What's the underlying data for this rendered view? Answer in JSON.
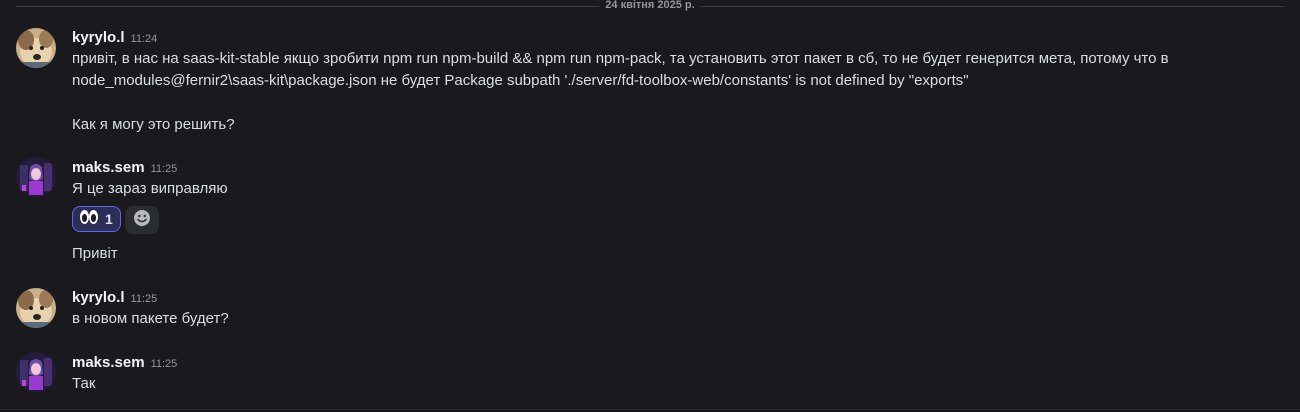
{
  "date_divider": "24 квітня 2025 р.",
  "messages": [
    {
      "username": "kyrylo.l",
      "time": "11:24",
      "lines": [
        "привіт, в нас на saas-kit-stable якщо зробити npm run npm-build && npm run npm-pack, та установить этот пакет в сб, то не будет генерится мета, потому что в",
        "node_modules@fernir2\\saas-kit\\package.json не будет Package subpath './server/fd-toolbox-web/constants' is not defined by \"exports\"",
        "Как я могу это решить?"
      ]
    },
    {
      "username": "maks.sem",
      "time": "11:25",
      "lines": [
        "Я це зараз виправляю",
        "Привіт"
      ],
      "reaction": {
        "emoji": "eyes-emoji",
        "count": "1"
      }
    },
    {
      "username": "kyrylo.l",
      "time": "11:25",
      "lines": [
        "в новом пакете будет?"
      ]
    },
    {
      "username": "maks.sem",
      "time": "11:25",
      "lines": [
        "Так"
      ]
    }
  ],
  "icons": {
    "add_reaction": "smiley-add-reaction-icon"
  },
  "colors": {
    "background": "#1a1a1e",
    "text": "#dbdee1",
    "username": "#f2f3f5",
    "muted": "#94959c",
    "reaction_border": "#5865f2",
    "reaction_bg": "#2b2f58"
  }
}
